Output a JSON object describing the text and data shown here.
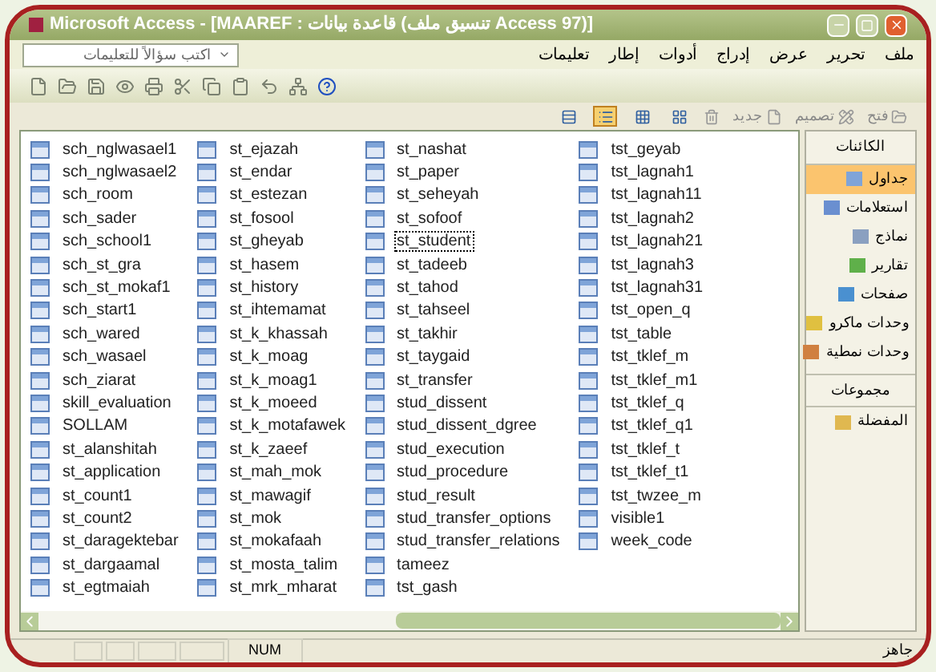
{
  "window": {
    "title": "Microsoft Access - [MAAREF : قاعدة بيانات (تنسيق ملف Access 97)]"
  },
  "menu": [
    "ملف",
    "تحرير",
    "عرض",
    "إدراج",
    "أدوات",
    "إطار",
    "تعليمات"
  ],
  "help_box": {
    "placeholder": "اكتب سؤالاً للتعليمات"
  },
  "db_toolbar": [
    {
      "label": "فتح",
      "kind": "open"
    },
    {
      "label": "تصميم",
      "kind": "design"
    },
    {
      "label": "جديد",
      "kind": "new"
    }
  ],
  "view_modes": [
    {
      "kind": "large",
      "selected": false
    },
    {
      "kind": "small",
      "selected": false
    },
    {
      "kind": "list",
      "selected": true
    },
    {
      "kind": "details",
      "selected": false
    }
  ],
  "objects": {
    "columns": [
      [
        {
          "name": "sch_nglwasael1",
          "focused": false
        },
        {
          "name": "sch_nglwasael2",
          "focused": false
        },
        {
          "name": "sch_room",
          "focused": false
        },
        {
          "name": "sch_sader",
          "focused": false
        },
        {
          "name": "sch_school1",
          "focused": false
        },
        {
          "name": "sch_st_gra",
          "focused": false
        },
        {
          "name": "sch_st_mokaf1",
          "focused": false
        },
        {
          "name": "sch_start1",
          "focused": false
        },
        {
          "name": "sch_wared",
          "focused": false
        },
        {
          "name": "sch_wasael",
          "focused": false
        },
        {
          "name": "sch_ziarat",
          "focused": false
        },
        {
          "name": "skill_evaluation",
          "focused": false
        },
        {
          "name": "SOLLAM",
          "focused": false
        },
        {
          "name": "st_alanshitah",
          "focused": false
        },
        {
          "name": "st_application",
          "focused": false
        },
        {
          "name": "st_count1",
          "focused": false
        },
        {
          "name": "st_count2",
          "focused": false
        },
        {
          "name": "st_daragektebar",
          "focused": false
        },
        {
          "name": "st_dargaamal",
          "focused": false
        },
        {
          "name": "st_egtmaiah",
          "focused": false
        }
      ],
      [
        {
          "name": "st_ejazah",
          "focused": false
        },
        {
          "name": "st_endar",
          "focused": false
        },
        {
          "name": "st_estezan",
          "focused": false
        },
        {
          "name": "st_fosool",
          "focused": false
        },
        {
          "name": "st_gheyab",
          "focused": false
        },
        {
          "name": "st_hasem",
          "focused": false
        },
        {
          "name": "st_history",
          "focused": false
        },
        {
          "name": "st_ihtemamat",
          "focused": false
        },
        {
          "name": "st_k_khassah",
          "focused": false
        },
        {
          "name": "st_k_moag",
          "focused": false
        },
        {
          "name": "st_k_moag1",
          "focused": false
        },
        {
          "name": "st_k_moeed",
          "focused": false
        },
        {
          "name": "st_k_motafawek",
          "focused": false
        },
        {
          "name": "st_k_zaeef",
          "focused": false
        },
        {
          "name": "st_mah_mok",
          "focused": false
        },
        {
          "name": "st_mawagif",
          "focused": false
        },
        {
          "name": "st_mok",
          "focused": false
        },
        {
          "name": "st_mokafaah",
          "focused": false
        },
        {
          "name": "st_mosta_talim",
          "focused": false
        },
        {
          "name": "st_mrk_mharat",
          "focused": false
        }
      ],
      [
        {
          "name": "st_nashat",
          "focused": false
        },
        {
          "name": "st_paper",
          "focused": false
        },
        {
          "name": "st_seheyah",
          "focused": false
        },
        {
          "name": "st_sofoof",
          "focused": false
        },
        {
          "name": "st_student",
          "focused": true
        },
        {
          "name": "st_tadeeb",
          "focused": false
        },
        {
          "name": "st_tahod",
          "focused": false
        },
        {
          "name": "st_tahseel",
          "focused": false
        },
        {
          "name": "st_takhir",
          "focused": false
        },
        {
          "name": "st_taygaid",
          "focused": false
        },
        {
          "name": "st_transfer",
          "focused": false
        },
        {
          "name": "stud_dissent",
          "focused": false
        },
        {
          "name": "stud_dissent_dgree",
          "focused": false
        },
        {
          "name": "stud_execution",
          "focused": false
        },
        {
          "name": "stud_procedure",
          "focused": false
        },
        {
          "name": "stud_result",
          "focused": false
        },
        {
          "name": "stud_transfer_options",
          "focused": false
        },
        {
          "name": "stud_transfer_relations",
          "focused": false
        },
        {
          "name": "tameez",
          "focused": false
        },
        {
          "name": "tst_gash",
          "focused": false
        }
      ],
      [
        {
          "name": "tst_geyab",
          "focused": false
        },
        {
          "name": "tst_lagnah1",
          "focused": false
        },
        {
          "name": "tst_lagnah11",
          "focused": false
        },
        {
          "name": "tst_lagnah2",
          "focused": false
        },
        {
          "name": "tst_lagnah21",
          "focused": false
        },
        {
          "name": "tst_lagnah3",
          "focused": false
        },
        {
          "name": "tst_lagnah31",
          "focused": false
        },
        {
          "name": "tst_open_q",
          "focused": false
        },
        {
          "name": "tst_table",
          "focused": false
        },
        {
          "name": "tst_tklef_m",
          "focused": false
        },
        {
          "name": "tst_tklef_m1",
          "focused": false
        },
        {
          "name": "tst_tklef_q",
          "focused": false
        },
        {
          "name": "tst_tklef_q1",
          "focused": false
        },
        {
          "name": "tst_tklef_t",
          "focused": false
        },
        {
          "name": "tst_tklef_t1",
          "focused": false
        },
        {
          "name": "tst_twzee_m",
          "focused": false
        },
        {
          "name": "visible1",
          "focused": false
        },
        {
          "name": "week_code",
          "focused": false
        }
      ]
    ]
  },
  "sidebar": {
    "objects_header": "الكائنات",
    "objects": [
      {
        "label": "جداول",
        "kind": "tables",
        "selected": true
      },
      {
        "label": "استعلامات",
        "kind": "queries",
        "selected": false
      },
      {
        "label": "نماذج",
        "kind": "forms",
        "selected": false
      },
      {
        "label": "تقارير",
        "kind": "reports",
        "selected": false
      },
      {
        "label": "صفحات",
        "kind": "pages",
        "selected": false
      },
      {
        "label": "وحدات ماكرو",
        "kind": "macros",
        "selected": false
      },
      {
        "label": "وحدات نمطية",
        "kind": "modules",
        "selected": false
      }
    ],
    "groups_header": "مجموعات",
    "groups": [
      {
        "label": "المفضلة",
        "kind": "favorites",
        "selected": false
      }
    ]
  },
  "status_bar": {
    "indicator": "NUM",
    "status": "جاهز"
  }
}
